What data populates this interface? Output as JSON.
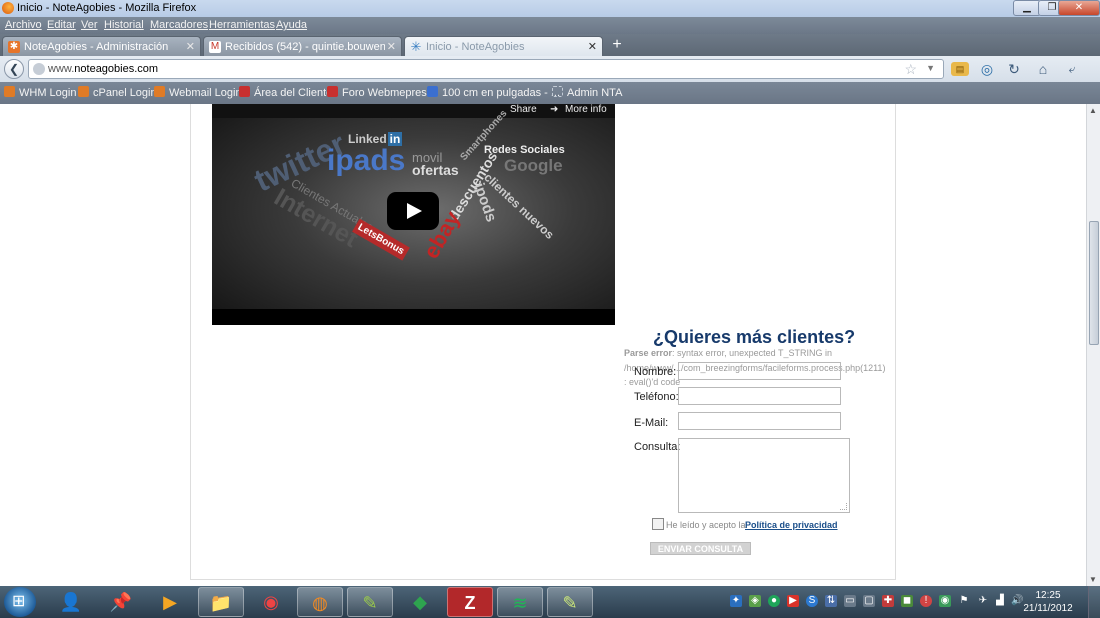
{
  "window": {
    "title": "Inicio - NoteAgobies - Mozilla Firefox"
  },
  "menu": [
    "Archivo",
    "Editar",
    "Ver",
    "Historial",
    "Marcadores",
    "Herramientas",
    "Ayuda"
  ],
  "tabs": [
    {
      "label": "NoteAgobies - Administración",
      "icon": "joomla-icon",
      "color": "#e6752b"
    },
    {
      "label": "Recibidos (542) - quintie.bouwens@g...",
      "icon": "gmail-icon",
      "color": "#c6372a"
    },
    {
      "label": "Inicio - NoteAgobies",
      "icon": "loading-spinner-icon",
      "color": "#3a7fc2"
    }
  ],
  "address": {
    "prefix": "www.",
    "domain": "noteagobies.com"
  },
  "bookmarks": [
    {
      "label": "WHM Login",
      "color": "#e07b26"
    },
    {
      "label": "cPanel Login",
      "color": "#e07b26"
    },
    {
      "label": "Webmail Login",
      "color": "#e07b26"
    },
    {
      "label": "Área del Cliente",
      "color": "#c8302f"
    },
    {
      "label": "Foro Webmepresa",
      "color": "#c8302f"
    },
    {
      "label": "100 cm en pulgadas - ...",
      "color": "#3b6fcf"
    },
    {
      "label": "Admin NTA",
      "color": "#9aa6b3"
    }
  ],
  "video": {
    "share": "Share",
    "more_info": "More info",
    "words": {
      "twitter": "twitter",
      "linkedin": "Linked",
      "linkedin_in": "in",
      "ipads": "ipads",
      "movil": "movil",
      "ofertas": "ofertas",
      "redes": "Redes Sociales",
      "smartphones": "Smartphones",
      "google": "Google",
      "descuentos": "descuentos",
      "clientes_nuevos": "clientes nuevos",
      "ipods": "ipods",
      "internet": "Internet",
      "clientes_actuales": "Clientes Actuales",
      "letsbonus": "LetsBonus",
      "ebay": "ebay"
    }
  },
  "form": {
    "title": "¿Quieres más clientes?",
    "error_label": "Parse error",
    "error_text": ": syntax error, unexpected T_STRING in /home/www/.../com_breezingforms/facileforms.process.php(1211) : eval()'d code",
    "fields": [
      {
        "label": "Nombre:",
        "value": ""
      },
      {
        "label": "Teléfono:",
        "value": ""
      },
      {
        "label": "E-Mail:",
        "value": ""
      }
    ],
    "consulta_label": "Consulta:",
    "consulta_value": "",
    "checkbox_text": "He leído y acepto la",
    "privacy_link": "Política de privacidad",
    "submit": "ENVIAR CONSULTA"
  },
  "taskbar": {
    "apps": [
      {
        "name": "start-button",
        "glyph": ""
      },
      {
        "name": "user-app-icon",
        "glyph": "👤"
      },
      {
        "name": "pin-app-icon",
        "glyph": "📌"
      },
      {
        "name": "media-player-icon",
        "glyph": "▶"
      },
      {
        "name": "file-explorer-icon",
        "glyph": "📁"
      },
      {
        "name": "chrome-icon",
        "glyph": "◉"
      },
      {
        "name": "firefox-icon",
        "glyph": "◍"
      },
      {
        "name": "editor-icon",
        "glyph": "✎"
      },
      {
        "name": "tool-icon",
        "glyph": "◆"
      },
      {
        "name": "filezilla-icon",
        "glyph": "Z"
      },
      {
        "name": "spotify-icon",
        "glyph": "≋"
      },
      {
        "name": "notepad-icon",
        "glyph": "✎"
      }
    ],
    "time": "12:25",
    "date": "21/11/2012"
  }
}
